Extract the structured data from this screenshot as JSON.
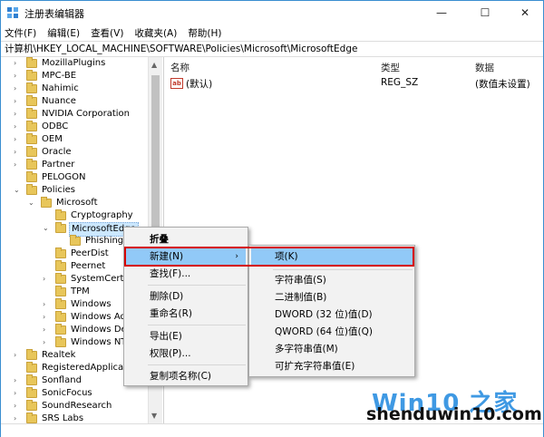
{
  "window": {
    "title": "注册表编辑器",
    "minimize": "—",
    "maximize": "☐",
    "close": "✕"
  },
  "menu": [
    "文件(F)",
    "编辑(E)",
    "查看(V)",
    "收藏夹(A)",
    "帮助(H)"
  ],
  "address": "计算机\\HKEY_LOCAL_MACHINE\\SOFTWARE\\Policies\\Microsoft\\MicrosoftEdge",
  "tree": [
    {
      "label": "MozillaPlugins",
      "exp": "›"
    },
    {
      "label": "MPC-BE",
      "exp": "›"
    },
    {
      "label": "Nahimic",
      "exp": "›"
    },
    {
      "label": "Nuance",
      "exp": "›"
    },
    {
      "label": "NVIDIA Corporation",
      "exp": "›"
    },
    {
      "label": "ODBC",
      "exp": "›"
    },
    {
      "label": "OEM",
      "exp": "›"
    },
    {
      "label": "Oracle",
      "exp": "›"
    },
    {
      "label": "Partner",
      "exp": "›"
    },
    {
      "label": "PELOGON",
      "exp": ""
    },
    {
      "label": "Policies",
      "exp": "⌄"
    },
    {
      "label": "Microsoft",
      "exp": "⌄"
    },
    {
      "label": "Cryptography",
      "exp": ""
    },
    {
      "label": "MicrosoftEdge",
      "exp": "⌄"
    },
    {
      "label": "PhishingFi",
      "exp": ""
    },
    {
      "label": "PeerDist",
      "exp": ""
    },
    {
      "label": "Peernet",
      "exp": ""
    },
    {
      "label": "SystemCertific",
      "exp": "›"
    },
    {
      "label": "TPM",
      "exp": ""
    },
    {
      "label": "Windows",
      "exp": "›"
    },
    {
      "label": "Windows Adv",
      "exp": "›"
    },
    {
      "label": "Windows Defe",
      "exp": "›"
    },
    {
      "label": "Windows NT",
      "exp": "›"
    },
    {
      "label": "Realtek",
      "exp": "›"
    },
    {
      "label": "RegisteredApplications",
      "exp": ""
    },
    {
      "label": "Sonfland",
      "exp": "›"
    },
    {
      "label": "SonicFocus",
      "exp": "›"
    },
    {
      "label": "SoundResearch",
      "exp": "›"
    },
    {
      "label": "SRS Labs",
      "exp": "›"
    }
  ],
  "columns": {
    "name": "名称",
    "type": "类型",
    "data": "数据"
  },
  "values": [
    {
      "icon": "ab",
      "name": "(默认)",
      "type": "REG_SZ",
      "data": "(数值未设置)"
    }
  ],
  "context_menu": {
    "collapse": "折叠",
    "new": "新建(N)",
    "find": "查找(F)...",
    "delete": "删除(D)",
    "rename": "重命名(R)",
    "export": "导出(E)",
    "permissions": "权限(P)...",
    "copy_name": "复制项名称(C)",
    "submenu_arrow": "›"
  },
  "submenu": {
    "key": "项(K)",
    "string": "字符串值(S)",
    "binary": "二进制值(B)",
    "dword": "DWORD (32 位)值(D)",
    "qword": "QWORD (64 位)值(Q)",
    "multi_string": "多字符串值(M)",
    "expandable_string": "可扩充字符串值(E)"
  },
  "watermark": {
    "logo": "Win10 之家",
    "site": "shenduwin10.com"
  },
  "colors": {
    "highlight": "#91c9f7",
    "red_box": "#d40000",
    "folder": "#e8c65a"
  }
}
